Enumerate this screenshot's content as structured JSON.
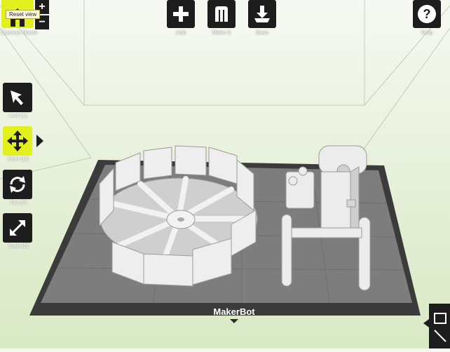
{
  "tooltip": {
    "text": "Reset view"
  },
  "camera": {
    "home_label": "Camera Home",
    "zoom_in": "+",
    "zoom_out": "−"
  },
  "toolbar": {
    "add_label": "Add",
    "make_label": "Make It",
    "save_label": "Save",
    "help_label": "Help"
  },
  "tools": [
    {
      "label": "Look (L)",
      "icon": "cursor-arrow-icon"
    },
    {
      "label": "Move (M)",
      "icon": "move-arrows-icon",
      "active": true
    },
    {
      "label": "Turn (T)",
      "icon": "rotate-arrows-icon"
    },
    {
      "label": "Scale (S)",
      "icon": "scale-diagonal-icon"
    }
  ],
  "platform": {
    "brand": "MakerBot"
  },
  "colors": {
    "accent": "#e2f11e",
    "button_bg": "#1d1d1d",
    "platform_border": "#3a3a3a",
    "platform_fill": "#7f7f7f",
    "model": "#e9e9e9"
  }
}
